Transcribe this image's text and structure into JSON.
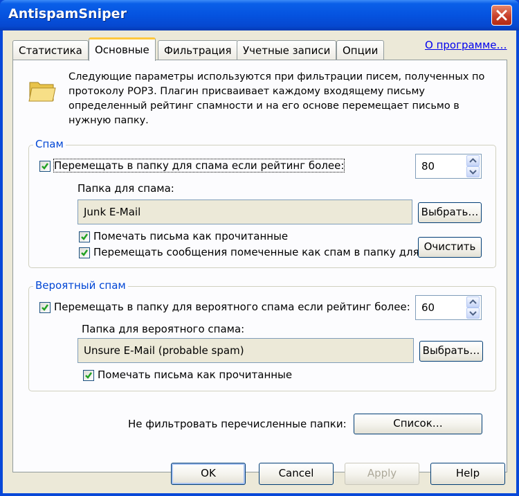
{
  "window": {
    "title": "AntispamSniper"
  },
  "tabs": [
    {
      "label": "Статистика"
    },
    {
      "label": "Основные"
    },
    {
      "label": "Фильтрация"
    },
    {
      "label": "Учетные записи"
    },
    {
      "label": "Опции"
    }
  ],
  "active_tab": "Основные",
  "about_link": "О программе…",
  "intro_text": "Следующие параметры используются при фильтрации писем, полученных по протоколу POP3. Плагин присваивает каждому входящему письму определенный рейтинг спамности и на его основе перемещает письмо в нужную папку.",
  "spam_group": {
    "legend": "Спам",
    "move_label": "Перемещать в папку для спама если рейтинг более:",
    "move_checked": true,
    "rating_value": "80",
    "folder_label": "Папка для спама:",
    "folder_value": "Junk E-Mail",
    "choose_button": "Выбрать…",
    "mark_read_label": "Помечать письма как прочитанные",
    "mark_read_checked": true,
    "move_marked_label": "Перемещать сообщения помеченные как спам в папку для",
    "move_marked_checked": true,
    "clear_button": "Очистить"
  },
  "probable_group": {
    "legend": "Вероятный спам",
    "move_label": "Перемещать в папку для вероятного спама если рейтинг более:",
    "move_checked": true,
    "rating_value": "60",
    "folder_label": "Папка для вероятного спама:",
    "folder_value": "Unsure E-Mail (probable spam)",
    "choose_button": "Выбрать…",
    "mark_read_label": "Помечать письма как прочитанные",
    "mark_read_checked": true
  },
  "exclude_folders_label": "Не фильтровать перечисленные папки:",
  "list_button": "Список…",
  "footer_buttons": {
    "ok": "OK",
    "cancel": "Cancel",
    "apply": "Apply",
    "help": "Help"
  },
  "icons": {
    "close": "close-icon",
    "folder": "folder-icon",
    "checkbox": "checkmark-icon",
    "spin_up": "arrow-up-icon",
    "spin_down": "arrow-down-icon"
  },
  "colors": {
    "title_bar": "#0553e0",
    "dialog_bg": "#ece9d8",
    "link": "#0000ee",
    "group_legend": "#0046d5",
    "active_tab_highlight": "#ffc83c"
  }
}
